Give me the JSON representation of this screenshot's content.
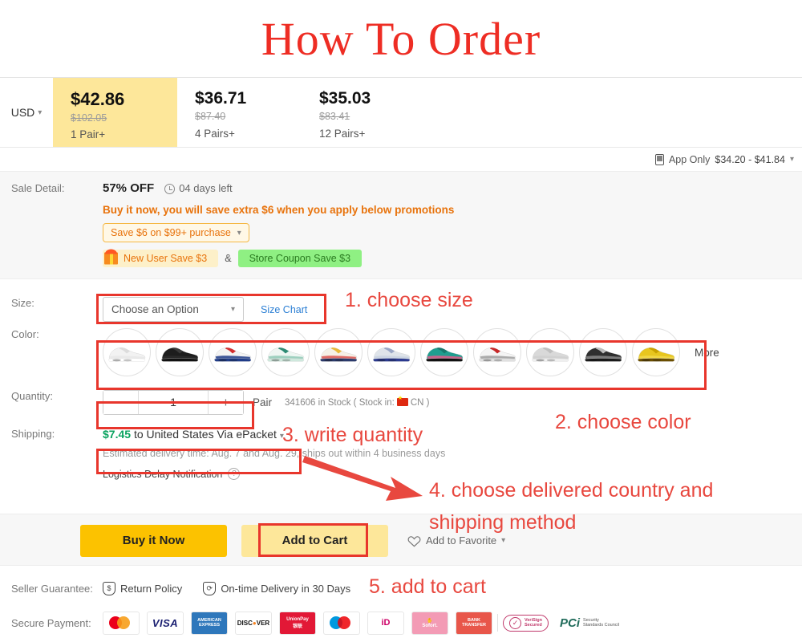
{
  "page": {
    "title": "How To Order"
  },
  "price": {
    "currency": "USD",
    "tiers": [
      {
        "price": "$42.86",
        "old": "$102.05",
        "unit": "1 Pair+",
        "active": true
      },
      {
        "price": "$36.71",
        "old": "$87.40",
        "unit": "4 Pairs+",
        "active": false
      },
      {
        "price": "$35.03",
        "old": "$83.41",
        "unit": "12 Pairs+",
        "active": false
      }
    ],
    "app_only_label": "App Only",
    "app_only_price": "$34.20 - $41.84"
  },
  "sale": {
    "label": "Sale Detail:",
    "discount": "57% OFF",
    "days_left": "04 days left",
    "promo_text": "Buy it now, you will save extra $6 when you apply below promotions",
    "coupon_chip": "Save $6 on $99+ purchase",
    "new_user_chip": "New User Save $3",
    "amp": "&",
    "store_coupon_chip": "Store Coupon Save $3"
  },
  "size": {
    "label": "Size:",
    "select_value": "Choose an Option",
    "size_chart": "Size Chart"
  },
  "color": {
    "label": "Color:",
    "more": "More",
    "swatches": [
      {
        "name": "white-triple-white",
        "body": "#f2f2f2",
        "accent": "#dcdcdc",
        "sole": "#ffffff",
        "mid": "#e8e8e8"
      },
      {
        "name": "black",
        "body": "#1d1d1d",
        "accent": "#3a3a3a",
        "sole": "#111111",
        "mid": "#2b2b2b"
      },
      {
        "name": "usa-red-white-blue",
        "body": "#f3f3f3",
        "accent": "#d32f2f",
        "sole": "#1f3c88",
        "mid": "#1f3c88"
      },
      {
        "name": "mint-green-white",
        "body": "#eef6f2",
        "accent": "#2e8b74",
        "sole": "#cfe8dd",
        "mid": "#8fc9b6"
      },
      {
        "name": "sean-wotherspoon-yellow",
        "body": "#f5f0e6",
        "accent": "#e8b93a",
        "sole": "#2b3a6b",
        "mid": "#d9534f"
      },
      {
        "name": "silver-blue-bullet",
        "body": "#dfe4ea",
        "accent": "#9aa7c7",
        "sole": "#2b3a8f",
        "mid": "#c9d2e0"
      },
      {
        "name": "teal-pink",
        "body": "#1f9e8f",
        "accent": "#18796e",
        "sole": "#111111",
        "mid": "#e8598b"
      },
      {
        "name": "white-red-grey",
        "body": "#f4f4f4",
        "accent": "#c62828",
        "sole": "#e0e0e0",
        "mid": "#9e9e9e"
      },
      {
        "name": "grey-silver",
        "body": "#d9d9d9",
        "accent": "#c0c0c0",
        "sole": "#efefef",
        "mid": "#cfcfcf"
      },
      {
        "name": "black-silver-gradient",
        "body": "#2f2f2f",
        "accent": "#bdbdbd",
        "sole": "#1a1a1a",
        "mid": "#8a8a8a"
      },
      {
        "name": "metallic-gold",
        "body": "#e8c61f",
        "accent": "#c9a200",
        "sole": "#6b4e00",
        "mid": "#f2d94e"
      }
    ]
  },
  "quantity": {
    "label": "Quantity:",
    "minus": "−",
    "plus": "+",
    "value": "1",
    "unit": "Pair",
    "stock_prefix": "341606 in Stock ( Stock in:",
    "stock_country": "CN )"
  },
  "shipping": {
    "label": "Shipping:",
    "price": "$7.45",
    "to": "to",
    "destination": "United States Via ePacket",
    "estimate": "Estimated delivery time: Aug. 7 and Aug. 29, ships out within 4 business days",
    "delay_notice": "Logistics Delay Notification",
    "help": "?"
  },
  "cta": {
    "buy_now": "Buy it Now",
    "add_to_cart": "Add to Cart",
    "favorite": "Add to Favorite"
  },
  "footer": {
    "guarantee_label": "Seller Guarantee:",
    "return_policy": "Return Policy",
    "on_time_delivery": "On-time Delivery in 30 Days",
    "payment_label": "Secure Payment:",
    "payments": [
      "mastercard",
      "visa",
      "american-express",
      "discover",
      "unionpay",
      "maestro",
      "ideal",
      "sofort",
      "bank-transfer"
    ],
    "trust_badges": [
      "verisign-secured",
      "pci-security-standards-council"
    ]
  },
  "annotations": [
    {
      "id": "step-1",
      "text": "1. choose size"
    },
    {
      "id": "step-2",
      "text": "2. choose color"
    },
    {
      "id": "step-3",
      "text": "3. write quantity"
    },
    {
      "id": "step-4-line1",
      "text": "4. choose delivered country and"
    },
    {
      "id": "step-4-line2",
      "text": "shipping method"
    },
    {
      "id": "step-5",
      "text": "5. add to cart"
    }
  ],
  "colors": {
    "annotation": "#e8483f",
    "box": "#e8362c",
    "accent": "#fcc200"
  }
}
